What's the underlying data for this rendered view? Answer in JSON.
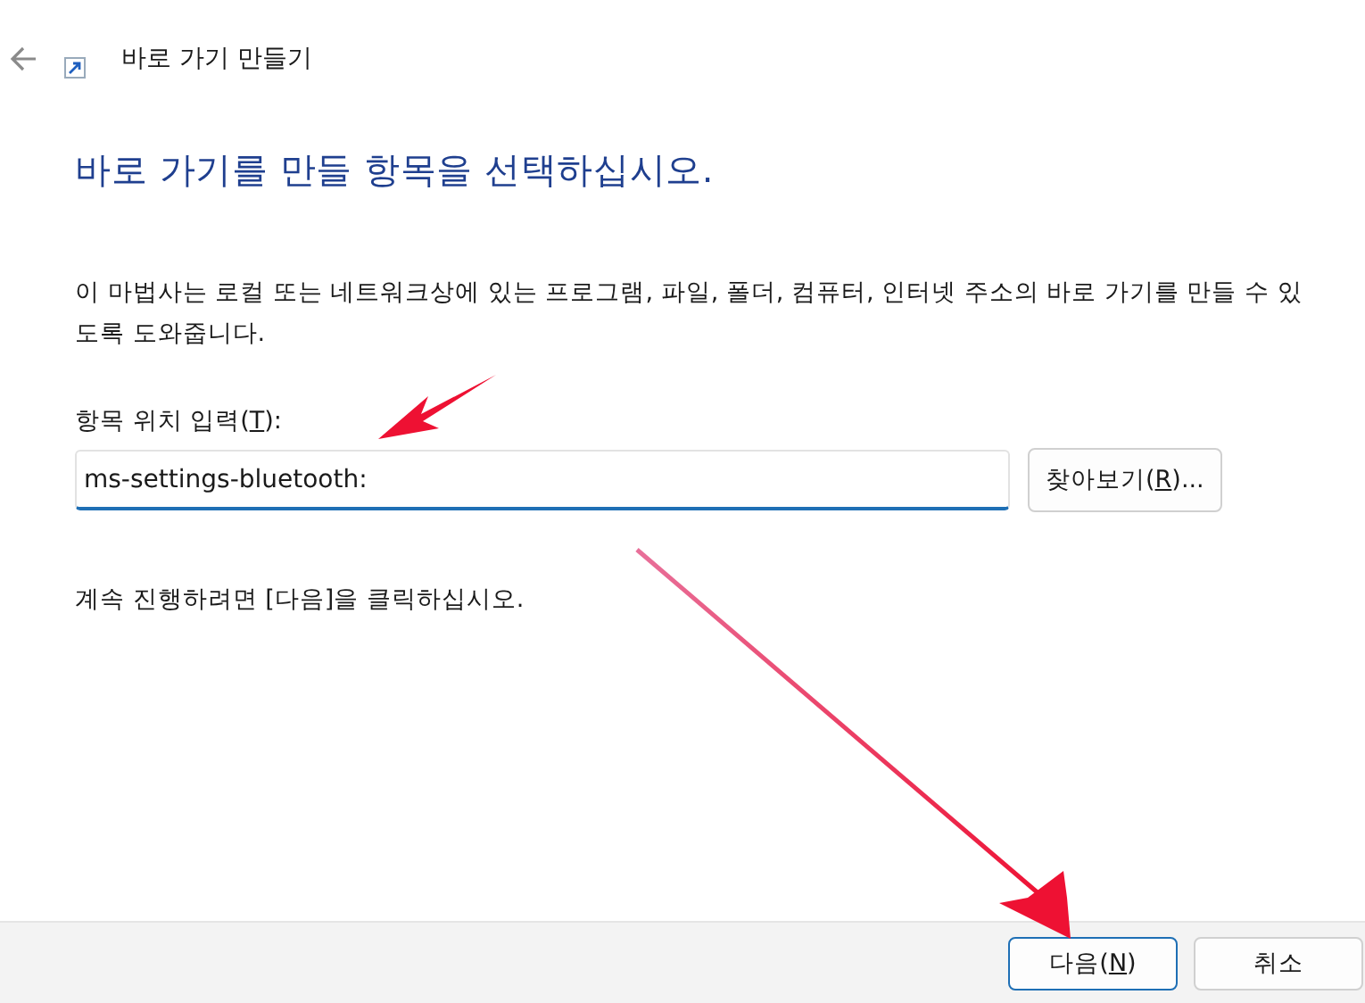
{
  "window": {
    "title": "바로 가기 만들기"
  },
  "heading": "바로 가기를 만들 항목을 선택하십시오.",
  "description": "이 마법사는 로컬 또는 네트워크상에 있는 프로그램, 파일, 폴더, 컴퓨터, 인터넷 주소의 바로 가기를 만들 수 있도록 도와줍니다.",
  "location": {
    "label": {
      "before": "항목 위치 입력(",
      "key": "T",
      "after": "):"
    },
    "value": "ms-settings-bluetooth:",
    "browse_button": {
      "before": "찾아보기(",
      "key": "R",
      "after": ")..."
    }
  },
  "hint": "계속 진행하려면 [다음]을 클릭하십시오.",
  "buttons": [
    {
      "before": "다음(",
      "key": "N",
      "after": ")",
      "kind": "default"
    },
    {
      "before": "취소",
      "kind": "normal"
    }
  ]
}
